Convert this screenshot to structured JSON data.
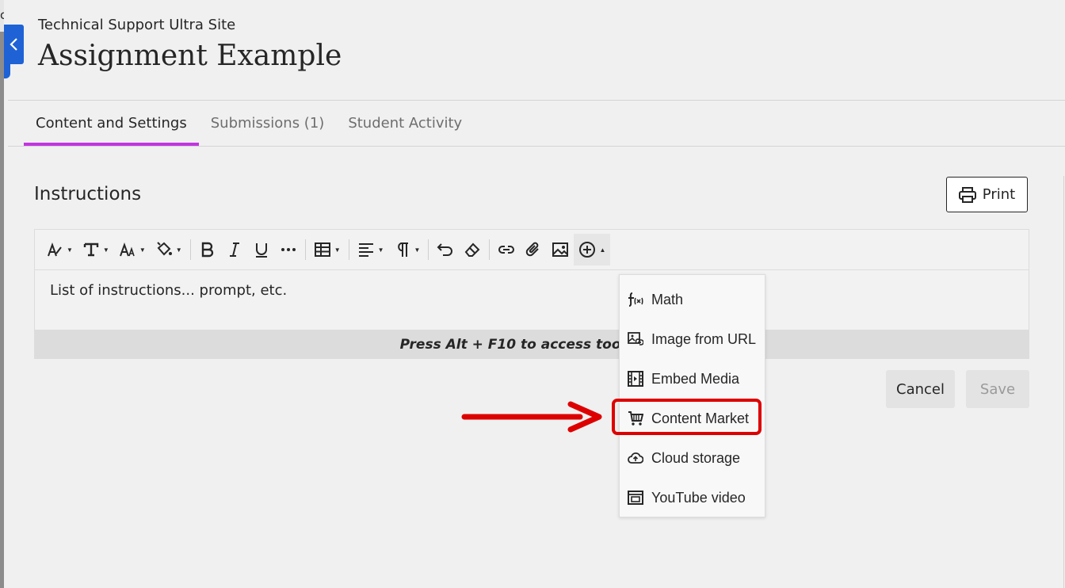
{
  "breadcrumb": {
    "site_name": "Technical Support Ultra Site",
    "edge_letter": "c"
  },
  "page": {
    "title": "Assignment Example"
  },
  "tabs": [
    {
      "label": "Content and Settings",
      "active": true
    },
    {
      "label": "Submissions (1)",
      "active": false
    },
    {
      "label": "Student Activity",
      "active": false
    }
  ],
  "instructions": {
    "heading": "Instructions",
    "print_label": "Print"
  },
  "editor": {
    "body_text": "List of instructions... prompt, etc.",
    "status_text": "Press Alt + F10 to access toolbar c",
    "toolbar_icons": [
      "paragraph-style-icon",
      "text-style-icon",
      "font-size-icon",
      "text-color-icon",
      "bold-icon",
      "italic-icon",
      "underline-icon",
      "more-icon",
      "table-icon",
      "align-icon",
      "paragraph-format-icon",
      "undo-icon",
      "clear-format-icon",
      "link-icon",
      "attach-icon",
      "image-icon",
      "insert-content-icon"
    ]
  },
  "insert_menu": {
    "items": [
      {
        "label": "Math",
        "icon": "math-icon"
      },
      {
        "label": "Image from URL",
        "icon": "image-url-icon"
      },
      {
        "label": "Embed Media",
        "icon": "film-icon"
      },
      {
        "label": "Content Market",
        "icon": "cart-icon",
        "highlighted": true
      },
      {
        "label": "Cloud storage",
        "icon": "cloud-upload-icon"
      },
      {
        "label": "YouTube video",
        "icon": "video-frame-icon"
      }
    ]
  },
  "actions": {
    "cancel_label": "Cancel",
    "save_label": "Save"
  },
  "colors": {
    "accent": "#c235e0",
    "close_tab": "#1e62d6",
    "annotation": "#dd0000"
  }
}
